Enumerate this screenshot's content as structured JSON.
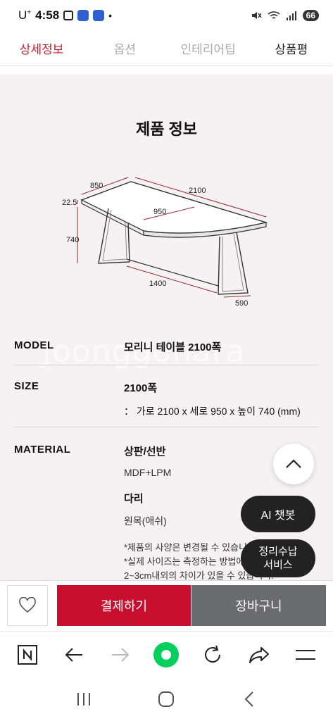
{
  "status": {
    "carrier": "U",
    "carrier_sup": "+",
    "time": "4:58",
    "dot": "•",
    "battery": "66"
  },
  "tabs": [
    {
      "label": "상세정보"
    },
    {
      "label": "옵션"
    },
    {
      "label": "인테리어팁"
    },
    {
      "label": "상품평"
    }
  ],
  "section_title": "제품 정보",
  "diagram": {
    "dims": {
      "depth": "850",
      "length": "2100",
      "thickness": "22.5",
      "inner_width": "950",
      "height": "740",
      "leg_span": "1400",
      "leg_depth": "590"
    }
  },
  "watermark": "Joonggonara",
  "specs": {
    "model_label": "MODEL",
    "model_value": "모리니 테이블 2100폭",
    "size_label": "SIZE",
    "size_value": "2100폭",
    "size_detail": "： 가로 2100 x 세로 950 x 높이 740  (mm)",
    "material_label": "MATERIAL",
    "top_title": "상판/선반",
    "top_value": "MDF+LPM",
    "leg_title": "다리",
    "leg_value": "원목(애쉬)",
    "note1": "*제품의 사양은 변경될 수 있습니다.",
    "note2": "*실제 사이즈는 측정하는 방법에",
    "note3": "2~3cm내외의 차이가 있을 수 있습니다."
  },
  "floating": {
    "ai_label": "AI 챗봇",
    "storage_line1": "정리수납",
    "storage_line2": "서비스"
  },
  "buy_bar": {
    "pay_label": "결제하기",
    "cart_label": "장바구니"
  },
  "colors": {
    "accent": "#c8102e",
    "cart": "#6b6c70",
    "bg": "#f6f1f3",
    "dim_line": "#a0282e"
  }
}
